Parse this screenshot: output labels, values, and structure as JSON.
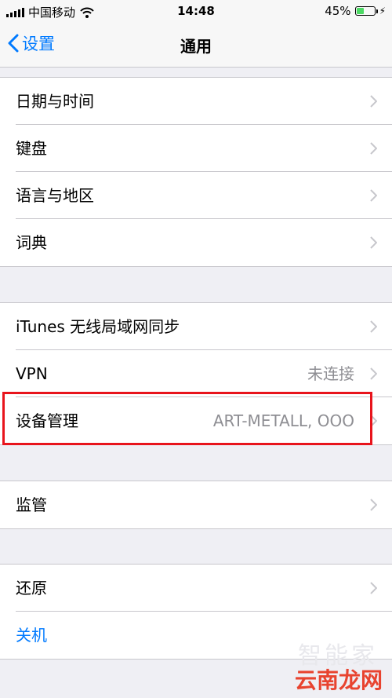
{
  "status": {
    "carrier": "中国移动",
    "time": "14:48",
    "battery": "45%",
    "battery_level": 0.45
  },
  "nav": {
    "back_label": "设置",
    "title": "通用"
  },
  "groups": [
    {
      "rows": [
        {
          "label": "日期与时间"
        },
        {
          "label": "键盘"
        },
        {
          "label": "语言与地区"
        },
        {
          "label": "词典"
        }
      ]
    },
    {
      "rows": [
        {
          "label": "iTunes 无线局域网同步"
        },
        {
          "label": "VPN",
          "detail": "未连接"
        },
        {
          "label": "设备管理",
          "detail": "ART-METALL, OOO"
        }
      ]
    },
    {
      "rows": [
        {
          "label": "监管"
        }
      ]
    },
    {
      "rows": [
        {
          "label": "还原"
        },
        {
          "label": "关机"
        }
      ]
    }
  ],
  "watermark": {
    "top": "智能家",
    "bottom": "云南龙网"
  },
  "colors": {
    "accent": "#007aff",
    "highlight": "#e8141c",
    "battery": "#4cd964"
  }
}
